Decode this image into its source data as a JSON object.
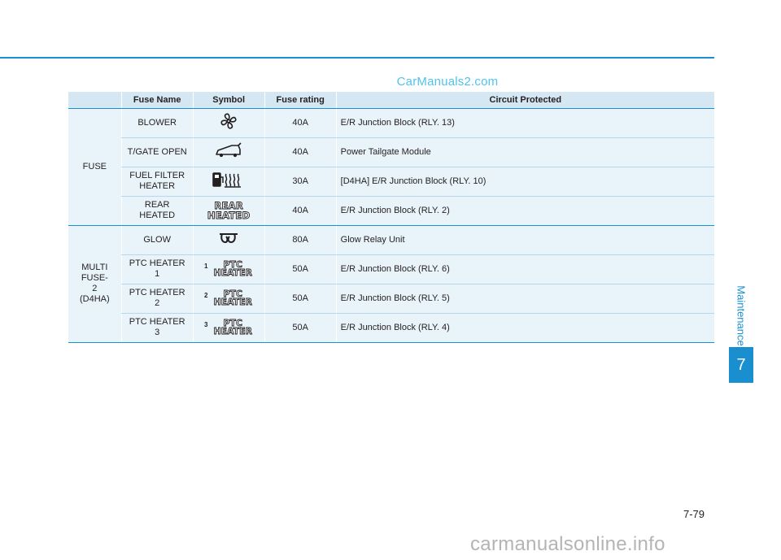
{
  "watermark_top": "CarManuals2.com",
  "watermark_bottom": "carmanualsonline.info",
  "section": {
    "label": "Maintenance",
    "number": "7"
  },
  "page_number": "7-79",
  "table": {
    "headers": {
      "fuse_name": "Fuse Name",
      "symbol": "Symbol",
      "fuse_rating": "Fuse rating",
      "circuit": "Circuit Protected"
    },
    "groups": [
      {
        "name": "FUSE",
        "rows": [
          {
            "fuse_name": "BLOWER",
            "symbol_icon": "fan-icon",
            "rating": "40A",
            "circuit": "E/R Junction Block (RLY. 13)"
          },
          {
            "fuse_name": "T/GATE OPEN",
            "symbol_icon": "tailgate-open-icon",
            "rating": "40A",
            "circuit": "Power Tailgate Module"
          },
          {
            "fuse_name": "FUEL FILTER HEATER",
            "symbol_icon": "fuel-filter-heater-icon",
            "rating": "30A",
            "circuit": "[D4HA] E/R Junction Block (RLY. 10)"
          },
          {
            "fuse_name": "REAR HEATED",
            "symbol_text": "REAR HEATED",
            "rating": "40A",
            "circuit": "E/R Junction Block (RLY. 2)"
          }
        ]
      },
      {
        "name": "MULTI FUSE-2 (D4HA)",
        "rows": [
          {
            "fuse_name": "GLOW",
            "symbol_icon": "glow-plug-icon",
            "rating": "80A",
            "circuit": "Glow Relay Unit"
          },
          {
            "fuse_name": "PTC HEATER 1",
            "symbol_num": "1",
            "symbol_text": "PTC HEATER",
            "rating": "50A",
            "circuit": "E/R Junction Block (RLY. 6)"
          },
          {
            "fuse_name": "PTC HEATER 2",
            "symbol_num": "2",
            "symbol_text": "PTC HEATER",
            "rating": "50A",
            "circuit": "E/R Junction Block (RLY. 5)"
          },
          {
            "fuse_name": "PTC HEATER 3",
            "symbol_num": "3",
            "symbol_text": "PTC HEATER",
            "rating": "50A",
            "circuit": "E/R Junction Block (RLY. 4)"
          }
        ]
      }
    ]
  },
  "colors": {
    "accent": "#1a8fd0",
    "header_bg": "#d5e7f3",
    "row_bg": "#e9f3fa"
  }
}
